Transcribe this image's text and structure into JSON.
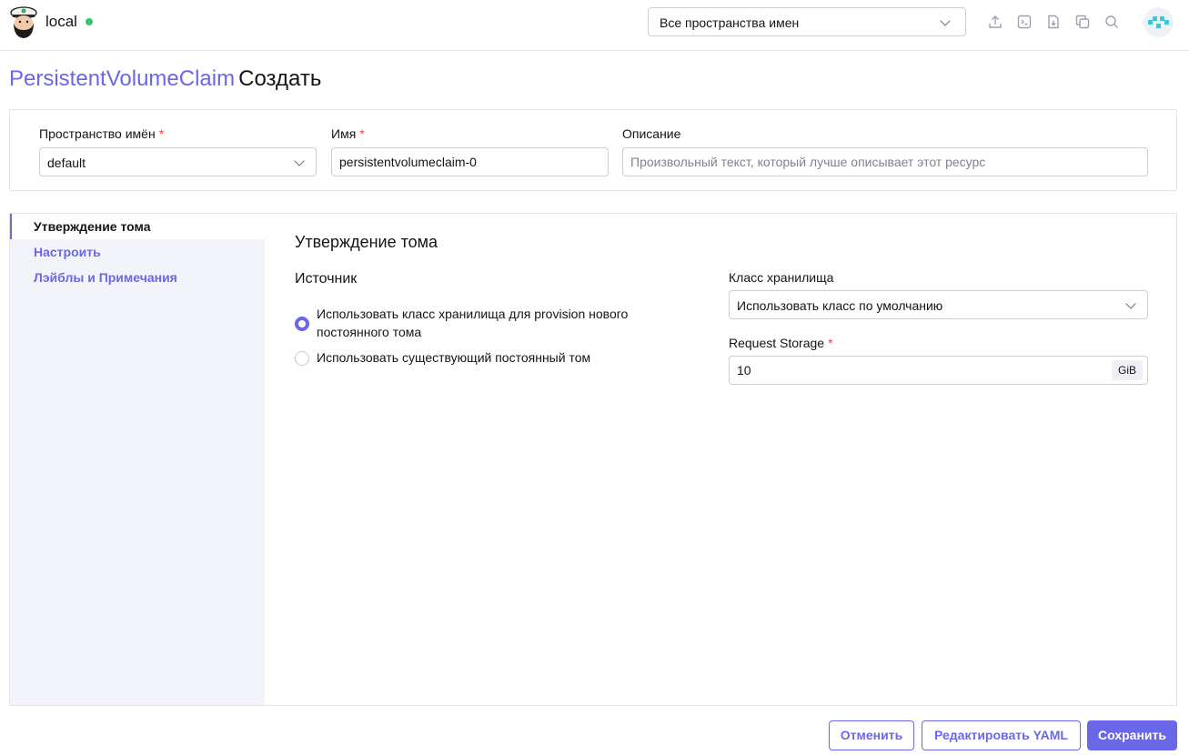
{
  "header": {
    "cluster_name": "local",
    "namespace_select": "Все пространства имен",
    "icons": [
      "upload-icon",
      "terminal-icon",
      "import-file-icon",
      "copy-icon",
      "search-icon"
    ]
  },
  "title": {
    "resource": "PersistentVolumeClaim",
    "action": "Создать"
  },
  "form": {
    "namespace_label": "Пространство имён",
    "namespace_value": "default",
    "name_label": "Имя",
    "name_value": "persistentvolumeclaim-0",
    "description_label": "Описание",
    "description_placeholder": "Произвольный текст, который лучше описывает этот ресурс",
    "required_mark": "*"
  },
  "sidebar": {
    "items": [
      {
        "label": "Утверждение тома",
        "active": true
      },
      {
        "label": "Настроить",
        "active": false
      },
      {
        "label": "Лэйблы и Примечания",
        "active": false
      }
    ]
  },
  "section": {
    "title": "Утверждение тома",
    "source_title": "Источник",
    "radio_new_line1": "Использовать класс хранилища для provision нового",
    "radio_new_line2": "постоянного тома",
    "radio_new_selected": true,
    "radio_existing": "Использовать существующий постоянный том",
    "storage_class_label": "Класс хранилища",
    "storage_class_value": "Использовать класс по умолчанию",
    "request_storage_label": "Request Storage",
    "request_storage_value": "10",
    "request_storage_unit": "GiB"
  },
  "footer": {
    "cancel": "Отменить",
    "edit_yaml": "Редактировать YAML",
    "save": "Сохранить"
  },
  "colors": {
    "accent": "#6a67e8",
    "status_green": "#35c46a",
    "required": "#e5404f"
  }
}
